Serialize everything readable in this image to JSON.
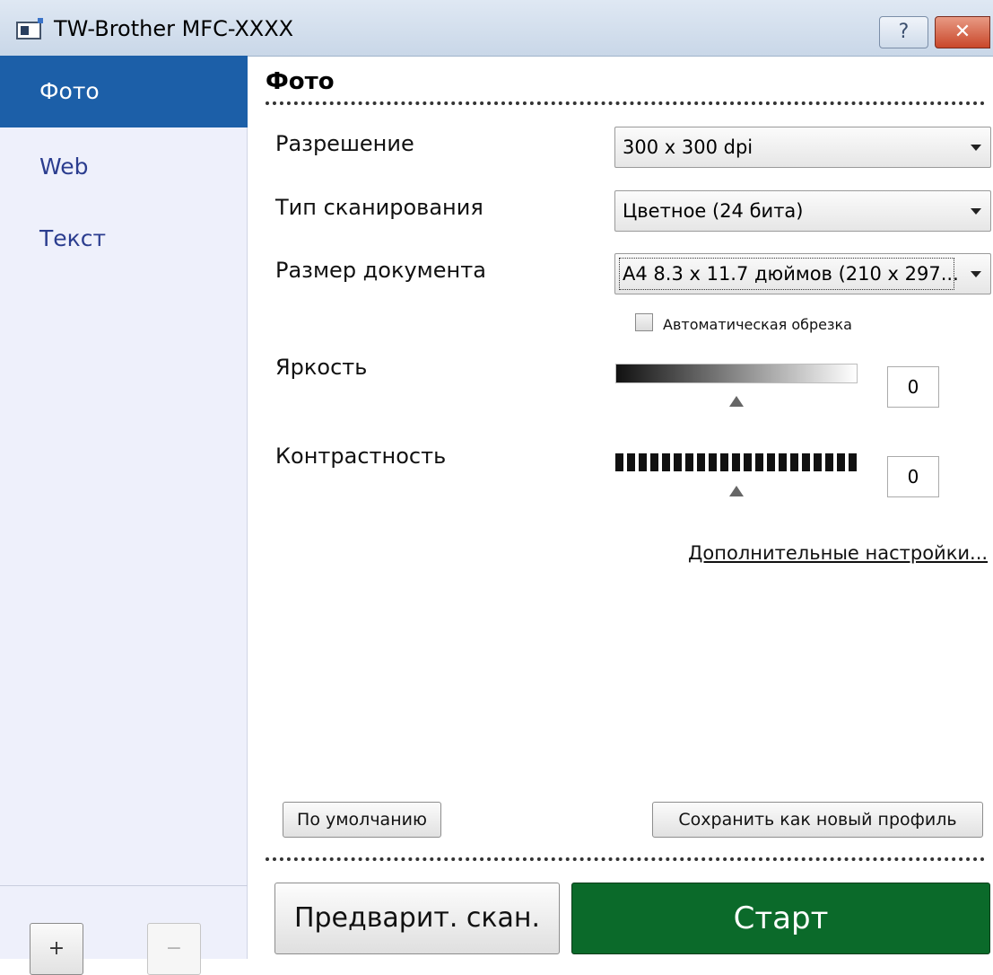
{
  "window": {
    "title": "TW-Brother MFC-XXXX",
    "help_label": "?",
    "close_label": "✕"
  },
  "sidebar": {
    "items": [
      {
        "label": "Фото",
        "active": true
      },
      {
        "label": "Web",
        "active": false
      },
      {
        "label": "Текст",
        "active": false
      }
    ],
    "add_label": "+",
    "remove_label": "−"
  },
  "main": {
    "section_title": "Фото",
    "resolution": {
      "label": "Разрешение",
      "value": "300 x 300 dpi"
    },
    "scan_type": {
      "label": "Тип сканирования",
      "value": "Цветное (24 бита)"
    },
    "document_size": {
      "label": "Размер документа",
      "value": "А4 8.3 x 11.7 дюймов (210 x 297..."
    },
    "auto_crop": {
      "label": "Автоматическая обрезка",
      "checked": false
    },
    "brightness": {
      "label": "Яркость",
      "value": "0"
    },
    "contrast": {
      "label": "Контрастность",
      "value": "0"
    },
    "advanced_link": "Дополнительные настройки...",
    "default_button": "По умолчанию",
    "save_profile_button": "Сохранить как новый профиль",
    "preview_button": "Предварит. скан.",
    "start_button": "Старт"
  },
  "colors": {
    "sidebar_bg": "#eef0fb",
    "sidebar_active": "#1c5fa8",
    "sidebar_text": "#2b3d8f",
    "start_bg": "#0b6a2a"
  }
}
